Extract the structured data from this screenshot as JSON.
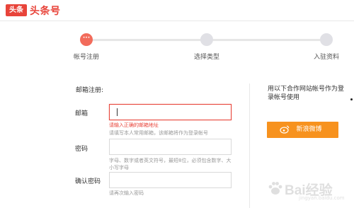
{
  "header": {
    "logo_badge": "头条",
    "logo_text": "头条号"
  },
  "stepper": {
    "active_dot": "···",
    "steps": [
      {
        "label": "帐号注册",
        "active": true
      },
      {
        "label": "选择类型",
        "active": false
      },
      {
        "label": "入驻资料",
        "active": false
      }
    ]
  },
  "form": {
    "section_title": "邮箱注册:",
    "email": {
      "label": "邮箱",
      "value": "",
      "error": "请输入正确的邮箱地址",
      "hint": "请填写本人常用邮箱，该邮箱将作为登录帐号"
    },
    "password": {
      "label": "密码",
      "value": "",
      "hint": "字母、数字或者英文符号，最短8位，必须包含数字、大小写字母"
    },
    "confirm_password": {
      "label": "确认密码",
      "value": "",
      "hint": "请再次输入密码"
    }
  },
  "partner": {
    "text": "用以下合作网站帐号作为登录帐号使用",
    "weibo_button": "新浪微博",
    "weibo_icon": "weibo-icon",
    "button_color": "#f7921e"
  },
  "colors": {
    "brand": "#e8443a",
    "error": "#e8443a"
  },
  "watermark": {
    "text": "Bai经验",
    "sub": "jingyan.baidu.com"
  }
}
